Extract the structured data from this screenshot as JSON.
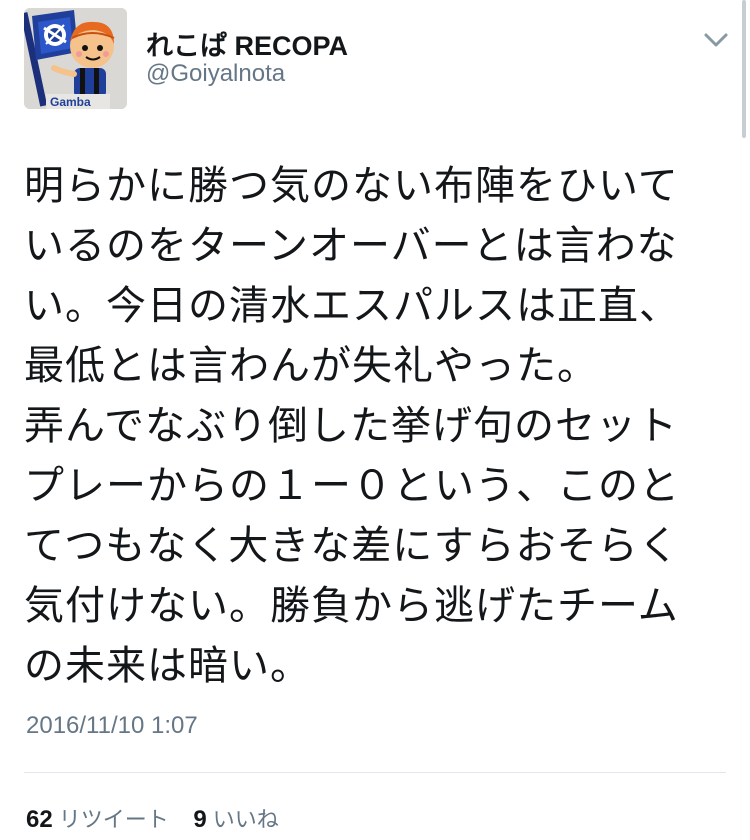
{
  "tweet": {
    "author": {
      "display_name": "れこぱ RECOPA",
      "handle": "@Goiyalnota",
      "avatar_badge_text": "Gamba"
    },
    "text_lines": [
      "明らかに勝つ気のない布陣をひいて",
      "いるのをターンオーバーとは言わな",
      "い。今日の清水エスパルスは正直、",
      "最低とは言わんが失礼やった。",
      "弄んでなぶり倒した挙げ句のセット",
      "プレーからの１ー０という、このと",
      "てつもなく大きな差にすらおそらく",
      "気付けない。勝負から逃げたチーム",
      "の未来は暗い。"
    ],
    "timestamp": "2016/11/10 1:07",
    "stats": {
      "retweets_count": "62",
      "retweets_label": "リツイート",
      "likes_count": "9",
      "likes_label": "いいね"
    }
  },
  "colors": {
    "text_primary": "#14171a",
    "text_secondary": "#657786",
    "divider": "#e1e8ed",
    "gamba_blue": "#1f3f9b"
  },
  "icons": {
    "menu": "chevron-down-icon"
  }
}
